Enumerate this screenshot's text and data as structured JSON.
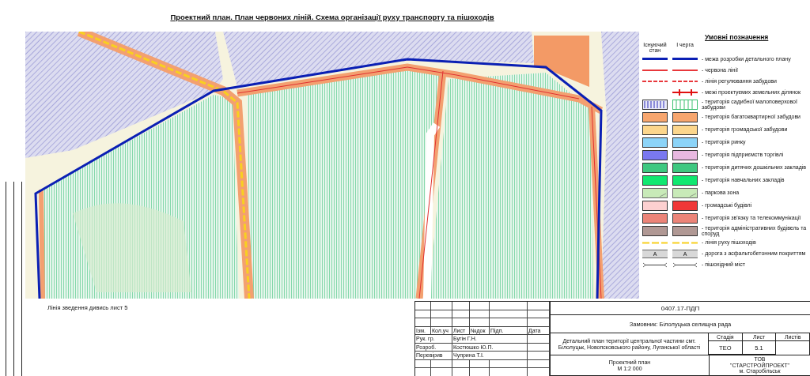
{
  "title": "Проектний план. План червоних ліній. Схема організації руху транспорту та пішоходів",
  "legend": {
    "title": "Умовні позначення",
    "columns": [
      "Існуючий стан",
      "I черга"
    ],
    "items": [
      {
        "label": "- межа розробки детального плану",
        "existing": {
          "kind": "line",
          "color": "#0a1fb4"
        },
        "stage": {
          "kind": "line",
          "color": "#0a1fb4"
        }
      },
      {
        "label": "- червона лінії",
        "existing": {
          "kind": "thin",
          "color": "#e8383c"
        },
        "stage": {
          "kind": "thin",
          "color": "#e8383c"
        }
      },
      {
        "label": "- лінія регулювання забудови",
        "existing": {
          "kind": "dashed",
          "color": "#e8383c"
        },
        "stage": {
          "kind": "dashed",
          "color": "#e8383c"
        }
      },
      {
        "label": "- межі проектуємих земельних ділянок",
        "stage": {
          "kind": "parcel",
          "color": "#e01010"
        }
      },
      {
        "label": "- територія садибної малоповерхової забудови",
        "existing": {
          "kind": "hatch",
          "color": "#8a8ad8"
        },
        "stage": {
          "kind": "stripes",
          "color": "#3cc070"
        }
      },
      {
        "label": "- територія багатоквартирної забудови",
        "existing": {
          "kind": "fill",
          "color": "#f7a66e"
        },
        "stage": {
          "kind": "fill",
          "color": "#f7a66e"
        }
      },
      {
        "label": "- територія громадської забудови",
        "existing": {
          "kind": "fill",
          "color": "#fcd68c"
        },
        "stage": {
          "kind": "fill",
          "color": "#fcd68c"
        }
      },
      {
        "label": "- територія ринку",
        "existing": {
          "kind": "fill",
          "color": "#8cd4f8"
        },
        "stage": {
          "kind": "fill",
          "color": "#8cd4f8"
        }
      },
      {
        "label": "- територія підприємств торгівлі",
        "existing": {
          "kind": "fill",
          "color": "#7a78f0"
        },
        "stage": {
          "kind": "fill",
          "color": "#e8b8e0"
        }
      },
      {
        "label": "- територія дитячих дошкільних закладів",
        "existing": {
          "kind": "fill",
          "color": "#3ec880"
        },
        "stage": {
          "kind": "fill",
          "color": "#3ec880"
        }
      },
      {
        "label": "- територія навчальних закладів",
        "existing": {
          "kind": "fill",
          "color": "#10e870"
        },
        "stage": {
          "kind": "fill",
          "color": "#10e870"
        }
      },
      {
        "label": "- паркова зона",
        "existing": {
          "kind": "park",
          "color": "#c8eab8"
        },
        "stage": {
          "kind": "park",
          "color": "#c8eab8"
        }
      },
      {
        "label": "- громадські будівлі",
        "existing": {
          "kind": "fill",
          "color": "#fcd0d0"
        },
        "stage": {
          "kind": "fill",
          "color": "#f03838"
        }
      },
      {
        "label": "- територія зв'язку та телекоммунікації",
        "existing": {
          "kind": "fill",
          "color": "#ec8478"
        },
        "stage": {
          "kind": "fill",
          "color": "#ec8478"
        }
      },
      {
        "label": "- територія адміністративних будівель та споруд",
        "existing": {
          "kind": "fill",
          "color": "#b09894"
        },
        "stage": {
          "kind": "fill",
          "color": "#b09894"
        }
      },
      {
        "label": "- лінія руху пішоходів",
        "existing": {
          "kind": "pedestrian",
          "color": "#f8d020"
        },
        "stage": {
          "kind": "pedestrian",
          "color": "#f8d020"
        }
      },
      {
        "label": "- дорога з асфальтобетонним покриттям",
        "existing": {
          "kind": "road",
          "color": "#d8d8d8",
          "text": "А"
        },
        "stage": {
          "kind": "road",
          "color": "#d8d8d8",
          "text": "А"
        }
      },
      {
        "label": "- пішохідний міст",
        "existing": {
          "kind": "bridge",
          "color": "#404040"
        },
        "stage": {
          "kind": "bridge",
          "color": "#404040"
        }
      }
    ]
  },
  "note": "Лінія зведення дивись лист 5",
  "stamp": {
    "code": "0407.17-ПДП",
    "customer": "Замовник: Білолуцька селищна рада",
    "header": [
      "Ізм.",
      "Кол.уч",
      "Лист",
      "№док",
      "Підп.",
      "Дата"
    ],
    "people": [
      {
        "role": "Рук. гр.",
        "name": "Бугін Г.Н."
      },
      {
        "role": "Розроб.",
        "name": "Костюшко Ю.П."
      },
      {
        "role": "Перевірив",
        "name": "Чуприна Т.І."
      }
    ],
    "description": "Детальний план території центральної частини смт. Білолуцьк, Новопсковського району, Луганської області",
    "stage_labels": [
      "Стадія",
      "Лист",
      "Листів"
    ],
    "stage_values": [
      "ТЕО",
      "5.1"
    ],
    "sheet_title": "Проектний план",
    "scale": "М 1:2 000",
    "company": [
      "ТОВ",
      "\"СТАРСТРОЙПРОЕКТ\"",
      "м. Старобільськ"
    ]
  }
}
